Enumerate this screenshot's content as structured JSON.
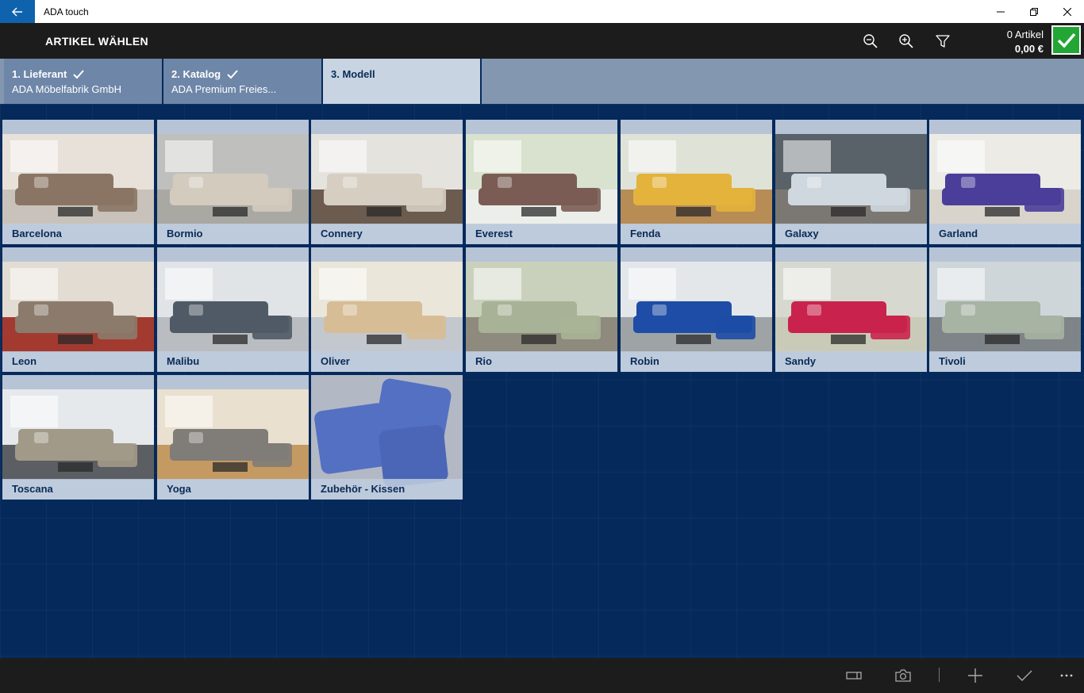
{
  "window": {
    "title": "ADA touch"
  },
  "header": {
    "title": "ARTIKEL WÄHLEN",
    "cart_count": "0 Artikel",
    "cart_total": "0,00 €"
  },
  "steps": [
    {
      "title": "1. Lieferant",
      "subtitle": "ADA Möbelfabrik GmbH",
      "done": true
    },
    {
      "title": "2. Katalog",
      "subtitle": "ADA Premium Freies...",
      "done": true
    },
    {
      "title": "3. Modell",
      "subtitle": "",
      "done": false
    }
  ],
  "models": [
    {
      "name": "Barcelona",
      "sofa_color": "#8a7565",
      "wall": "#e7e1da",
      "floor": "#c9c2ba"
    },
    {
      "name": "Bormio",
      "sofa_color": "#d3cbbd",
      "wall": "#bfc0bd",
      "floor": "#a9a8a3"
    },
    {
      "name": "Connery",
      "sofa_color": "#d6cec1",
      "wall": "#e5e3de",
      "floor": "#6b5c4f"
    },
    {
      "name": "Everest",
      "sofa_color": "#7a5c55",
      "wall": "#d9e2cf",
      "floor": "#eceee9"
    },
    {
      "name": "Fenda",
      "sofa_color": "#e3b33c",
      "wall": "#dfe2d7",
      "floor": "#b88c55"
    },
    {
      "name": "Galaxy",
      "sofa_color": "#cfd8df",
      "wall": "#5a6269",
      "floor": "#7b7873"
    },
    {
      "name": "Garland",
      "sofa_color": "#4a3e9a",
      "wall": "#ecebe6",
      "floor": "#d8d4cc"
    },
    {
      "name": "Leon",
      "sofa_color": "#8c7b6c",
      "wall": "#e2dcd2",
      "floor": "#a33a30"
    },
    {
      "name": "Malibu",
      "sofa_color": "#4f5a66",
      "wall": "#e1e4e6",
      "floor": "#b9bcc0"
    },
    {
      "name": "Oliver",
      "sofa_color": "#d7bd95",
      "wall": "#eae6da",
      "floor": "#c3c8cf"
    },
    {
      "name": "Rio",
      "sofa_color": "#a8b296",
      "wall": "#c9d1bc",
      "floor": "#8e8a7e"
    },
    {
      "name": "Robin",
      "sofa_color": "#1d4da6",
      "wall": "#e3e7ea",
      "floor": "#9ea3a6"
    },
    {
      "name": "Sandy",
      "sofa_color": "#c9234d",
      "wall": "#d7d9d1",
      "floor": "#c9cbb8"
    },
    {
      "name": "Tivoli",
      "sofa_color": "#a7b3a3",
      "wall": "#cfd6d9",
      "floor": "#7e8488"
    },
    {
      "name": "Toscana",
      "sofa_color": "#a29a88",
      "wall": "#e6e9ec",
      "floor": "#5b5f63"
    },
    {
      "name": "Yoga",
      "sofa_color": "#807c77",
      "wall": "#e9e0cf",
      "floor": "#c49a62"
    },
    {
      "name": "Zubehör - Kissen",
      "sofa_color": "#5470c2",
      "wall": "#b3b8c5",
      "floor": "#a8adb9"
    }
  ],
  "appbar": {
    "icons": [
      "panel-icon",
      "camera-icon",
      "add-icon",
      "accept-icon",
      "more-icon"
    ]
  },
  "colors": {
    "accent": "#0f63ad",
    "confirm": "#22a636",
    "background": "#05295a"
  }
}
